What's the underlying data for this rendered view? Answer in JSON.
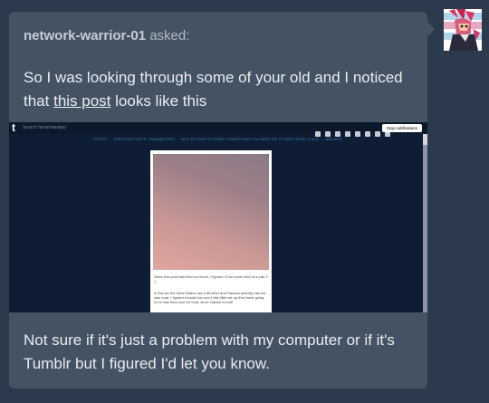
{
  "ask": {
    "asker_name": "network-warrior-01",
    "asked_label": " asked:",
    "question_part1": "So I was looking through some of your old and I noticed that ",
    "link_text": "this post",
    "question_part2": " looks like this",
    "question_end": "Not sure if it's just a problem with my computer or if it's Tumblr but I figured I'd let you know."
  },
  "screenshot": {
    "logo": "t",
    "search_placeholder": "Search furnet-fantasy",
    "notifications_button": "Stop notifications",
    "nav_items": [
      "POSTS",
      "CHECKING PASTE / PARAMETERS",
      "BOT: A FUNNY PICTURE? SOMETHING YOU WANT ME TO SEE? SEND IT ALL!",
      "ARCHIVE"
    ],
    "post_text_1_link": "this post",
    "post_text_1": "Since this post was liked so much, I figured I'd do some kind of a part 2 :)",
    "post_text_2": "In this pic the three kiddos are a bit older and Hanaza actually has her own coat. I figured it would be cool if this little set up they have going on is how they hunt for food, since Hanazi is built"
  },
  "colors": {
    "page_bg": "#2b3a4d",
    "card_bg": "#445364",
    "screenshot_bg": "#0f1d34"
  },
  "icons": [
    "heart-icon",
    "chat-icon",
    "code-icon",
    "home-icon",
    "compass-icon",
    "messages-icon",
    "lightning-icon",
    "account-icon"
  ]
}
